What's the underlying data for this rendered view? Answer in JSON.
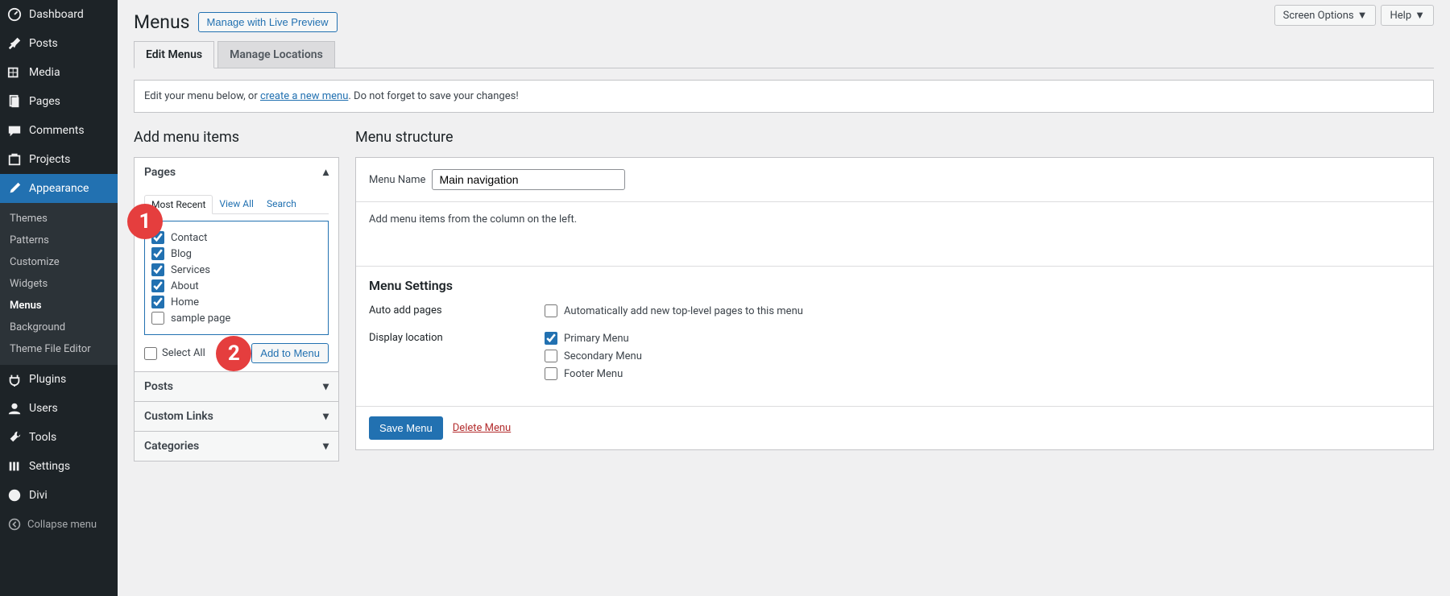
{
  "top_buttons": {
    "screen_options": "Screen Options",
    "help": "Help"
  },
  "sidebar": {
    "items": [
      {
        "label": "Dashboard"
      },
      {
        "label": "Posts"
      },
      {
        "label": "Media"
      },
      {
        "label": "Pages"
      },
      {
        "label": "Comments"
      },
      {
        "label": "Projects"
      },
      {
        "label": "Appearance",
        "active": true,
        "sub": [
          {
            "label": "Themes"
          },
          {
            "label": "Patterns"
          },
          {
            "label": "Customize"
          },
          {
            "label": "Widgets"
          },
          {
            "label": "Menus",
            "current": true
          },
          {
            "label": "Background"
          },
          {
            "label": "Theme File Editor"
          }
        ]
      },
      {
        "label": "Plugins"
      },
      {
        "label": "Users"
      },
      {
        "label": "Tools"
      },
      {
        "label": "Settings"
      },
      {
        "label": "Divi"
      }
    ],
    "collapse": "Collapse menu"
  },
  "header": {
    "title": "Menus",
    "preview_btn": "Manage with Live Preview"
  },
  "tabs": [
    {
      "label": "Edit Menus",
      "active": true
    },
    {
      "label": "Manage Locations"
    }
  ],
  "notice": {
    "pre": "Edit your menu below, or ",
    "link": "create a new menu",
    "post": ". Do not forget to save your changes!"
  },
  "left": {
    "title": "Add menu items",
    "accordions": [
      {
        "label": "Pages",
        "open": true
      },
      {
        "label": "Posts"
      },
      {
        "label": "Custom Links"
      },
      {
        "label": "Categories"
      }
    ],
    "sub_tabs": [
      {
        "label": "Most Recent",
        "active": true
      },
      {
        "label": "View All"
      },
      {
        "label": "Search"
      }
    ],
    "checkboxes": [
      {
        "label": "Contact",
        "checked": true
      },
      {
        "label": "Blog",
        "checked": true
      },
      {
        "label": "Services",
        "checked": true
      },
      {
        "label": "About",
        "checked": true
      },
      {
        "label": "Home",
        "checked": true
      },
      {
        "label": "sample page",
        "checked": false
      }
    ],
    "select_all": "Select All",
    "add_btn": "Add to Menu",
    "annotations": {
      "one": "1",
      "two": "2"
    }
  },
  "right": {
    "title": "Menu structure",
    "name_label": "Menu Name",
    "name_value": "Main navigation",
    "empty_msg": "Add menu items from the column on the left.",
    "settings": {
      "title": "Menu Settings",
      "auto_label": "Auto add pages",
      "auto_cb": "Automatically add new top-level pages to this menu",
      "loc_label": "Display location",
      "locations": [
        {
          "label": "Primary Menu",
          "checked": true
        },
        {
          "label": "Secondary Menu",
          "checked": false
        },
        {
          "label": "Footer Menu",
          "checked": false
        }
      ]
    },
    "save_btn": "Save Menu",
    "delete_link": "Delete Menu"
  }
}
